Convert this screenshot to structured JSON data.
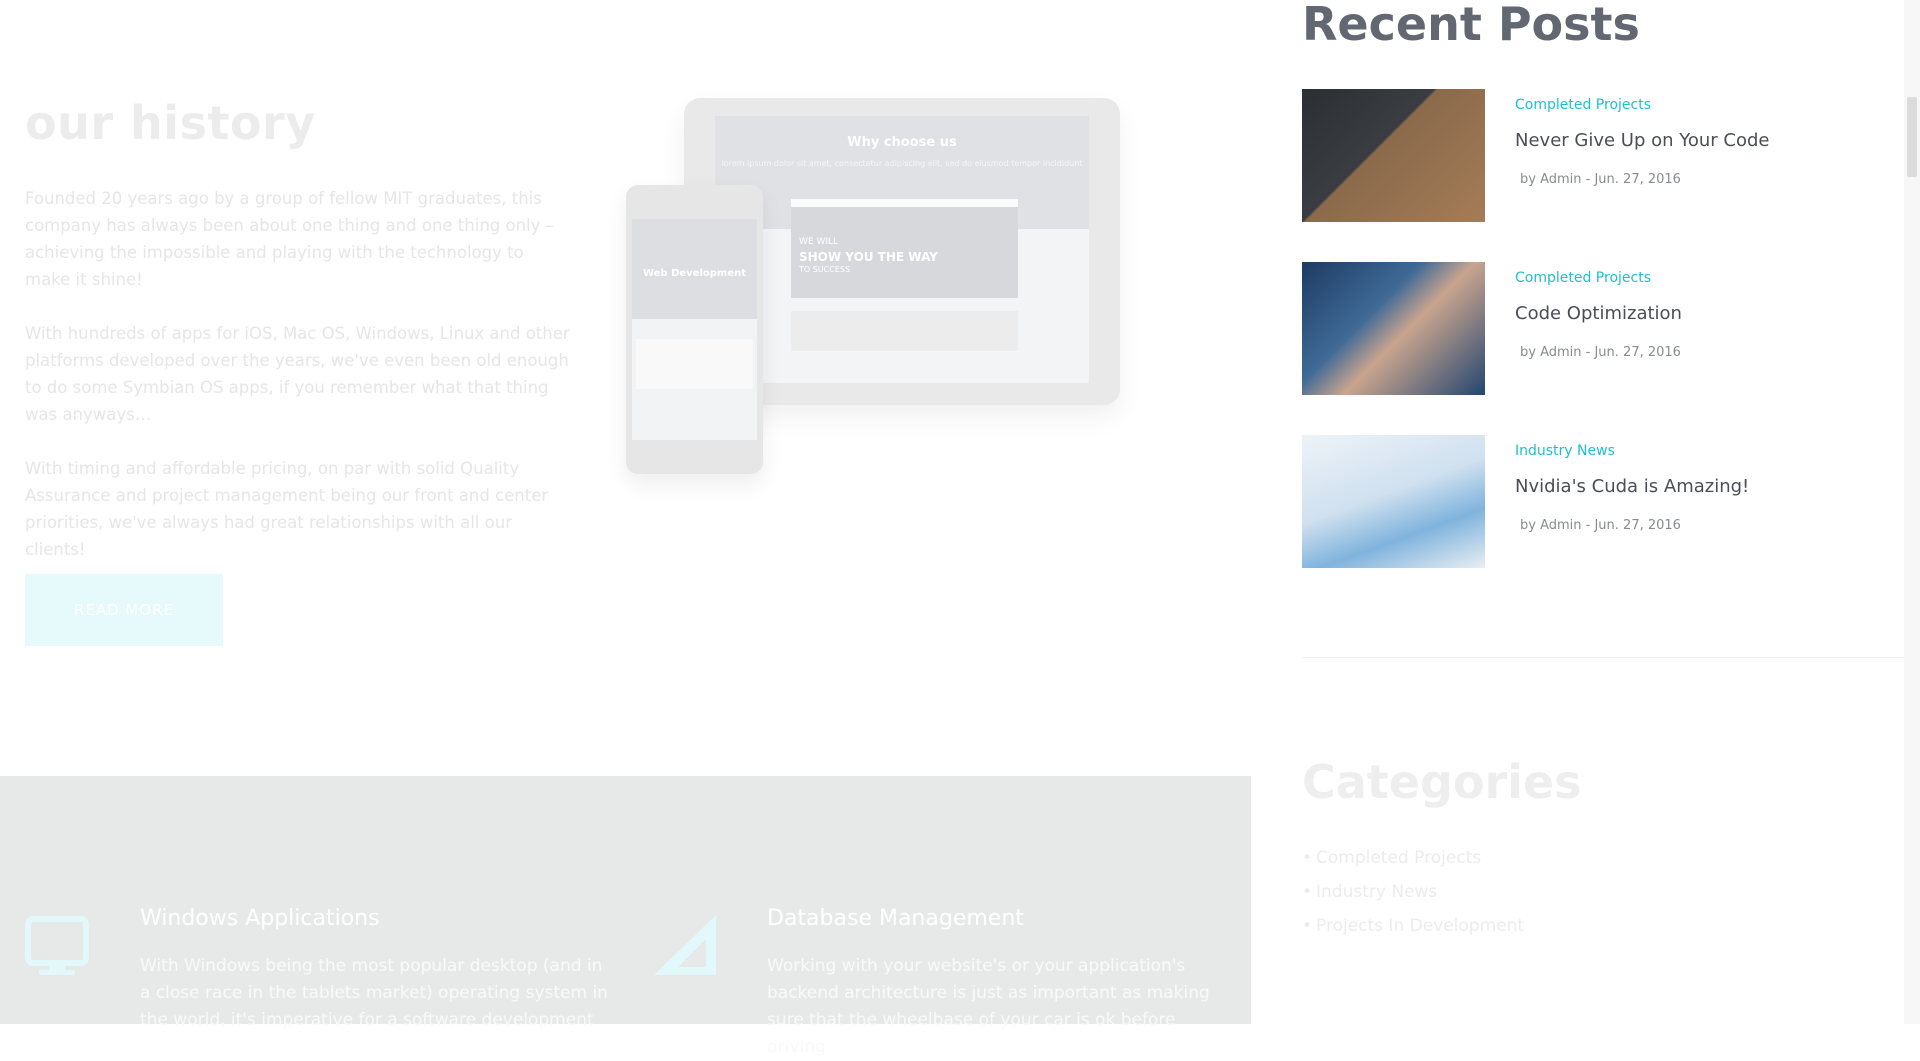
{
  "history": {
    "title": "our history",
    "paragraphs": [
      "Founded 20 years ago by a group of fellow MIT graduates, this company has always been about one thing and one thing only – achieving the impossible and playing with the technology to make it shine!",
      "With hundreds of apps for iOS, Mac OS, Windows, Linux and other platforms developed over the years, we've even been old enough to do some Symbian OS apps, if you remember what that thing was anyways…",
      "With timing and affordable pricing, on par with solid Quality Assurance and project management being our front and center priorities, we've always had great relationships with all our clients!"
    ],
    "read_more_label": "READ MORE"
  },
  "mockup": {
    "tablet_title": "Why choose us",
    "tablet_subtitle": "lorem ipsum dolor sit amet, consectetur adipiscing elit, sed do eiusmod tempor incididunt",
    "card_line1": "WE WILL",
    "card_line2": "SHOW YOU THE WAY",
    "card_line3": "TO SUCCESS",
    "phone_title": "Web Development"
  },
  "sidebar": {
    "recent_posts_title": "Recent Posts",
    "posts": [
      {
        "category": "Completed Projects",
        "title": "Never Give Up on Your Code",
        "meta": "by Admin  -  Jun. 27, 2016",
        "thumb_icon": "laptop-coffee-image"
      },
      {
        "category": "Completed Projects",
        "title": "Code Optimization",
        "meta": "by Admin  -  Jun. 27, 2016",
        "thumb_icon": "hand-phone-image"
      },
      {
        "category": "Industry News",
        "title": "Nvidia's Cuda is Amazing!",
        "meta": "by Admin  -  Jun. 27, 2016",
        "thumb_icon": "chart-laptop-image"
      }
    ],
    "categories_title": "Categories",
    "categories": [
      "Completed Projects",
      "Industry News",
      "Projects In Development"
    ]
  },
  "services": [
    {
      "icon": "monitor-icon",
      "title": "Windows Applications",
      "description": "With Windows being the most popular desktop (and in a close race in the tablets market) operating system in the world, it's imperative for a software development"
    },
    {
      "icon": "triangle-ruler-icon",
      "title": "Database Management",
      "description": "Working with your website's or your application's backend architecture is just as important as making sure that the wheelbase of your car is ok before driving"
    }
  ],
  "colors": {
    "accent": "#1ec0cf",
    "heading": "#626771",
    "post_title": "#4a4e57",
    "services_band": "#e7e9e9"
  }
}
